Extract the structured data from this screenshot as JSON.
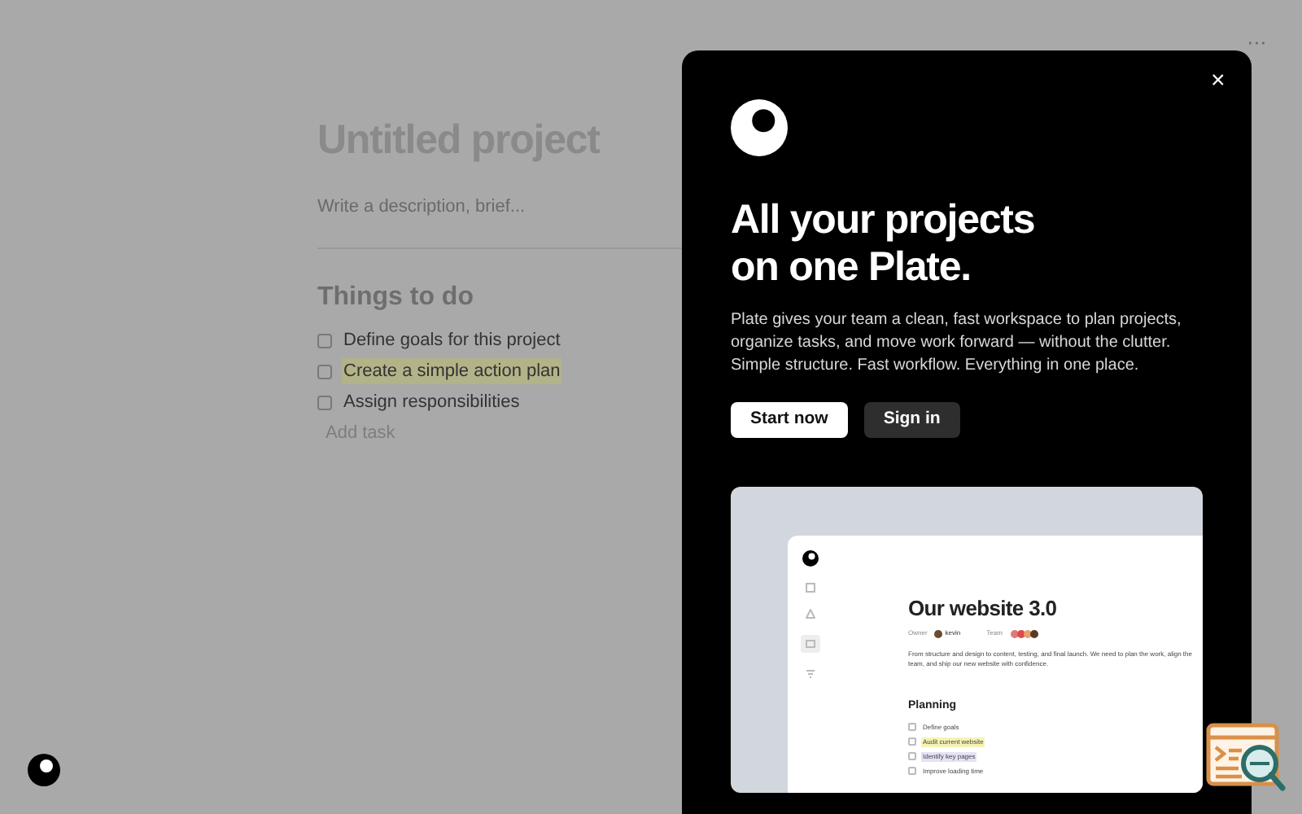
{
  "page": {
    "more": "···",
    "title": "Untitled project",
    "description_placeholder": "Write a description, brief...",
    "section_title": "Things to do",
    "tasks": [
      {
        "label": "Define goals for this project",
        "checked": false,
        "highlighted": false
      },
      {
        "label": "Create a simple action plan",
        "checked": false,
        "highlighted": true
      },
      {
        "label": "Assign responsibilities",
        "checked": false,
        "highlighted": false
      }
    ],
    "add_task": "Add task"
  },
  "modal": {
    "close": "×",
    "headline_lines": [
      "All your projects",
      "on one Plate."
    ],
    "body": "Plate gives your team a clean, fast workspace to plan projects, organize tasks, and move work forward — without the clutter. Simple structure. Fast workflow. Everything in one place.",
    "buttons": [
      {
        "label": "Start now",
        "kind": "primary"
      },
      {
        "label": "Sign in",
        "kind": "secondary"
      }
    ],
    "preview": {
      "title": "Our website 3.0",
      "owner_label": "Owner",
      "owner": "kevin",
      "team_label": "Team",
      "description": "From structure and design to content, testing, and final launch. We need to plan the work, align the team, and ship our new website with confidence.",
      "section": "Planning",
      "tasks": [
        {
          "label": "Define goals",
          "checked": false
        },
        {
          "label": "Audit current website",
          "checked": false,
          "color": "#f6f3b5"
        },
        {
          "label": "Identify key pages",
          "checked": false,
          "color": "#e6e2f6"
        },
        {
          "label": "Improve loading time",
          "checked": false
        }
      ]
    }
  }
}
